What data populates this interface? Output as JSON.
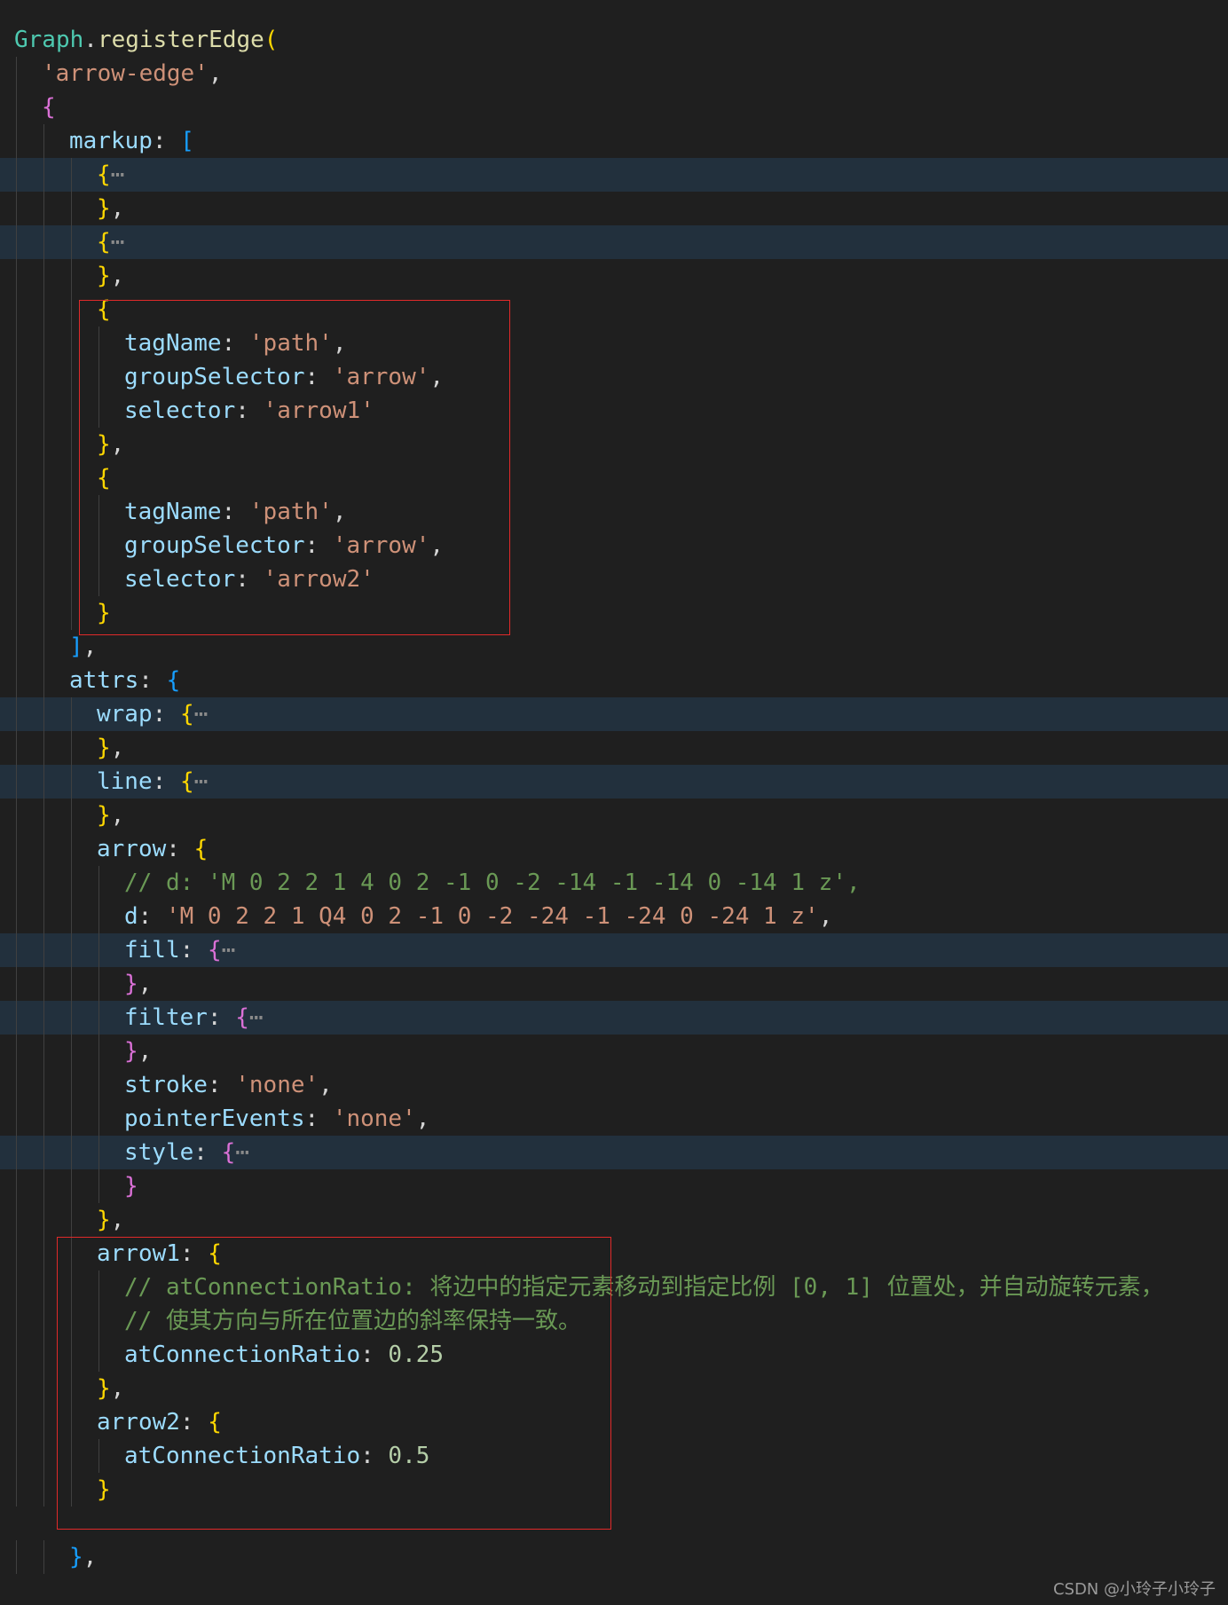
{
  "editor": {
    "colors": {
      "background": "#1f1f1f",
      "folded_line": "#22303d",
      "indent_guide": "#404040",
      "highlight_box": "#e02a2a"
    },
    "lines": [
      {
        "indent": 0,
        "folded": false,
        "tokens": [
          {
            "t": "Graph",
            "c": "#4ec9b0"
          },
          {
            "t": ".",
            "c": "#d4d4d4"
          },
          {
            "t": "registerEdge",
            "c": "#dcdcaa"
          },
          {
            "t": "(",
            "c": "#ffd700"
          }
        ]
      },
      {
        "indent": 1,
        "folded": false,
        "tokens": [
          {
            "t": "'arrow-edge'",
            "c": "#ce9178"
          },
          {
            "t": ",",
            "c": "#d4d4d4"
          }
        ]
      },
      {
        "indent": 1,
        "folded": false,
        "tokens": [
          {
            "t": "{",
            "c": "#da70d6"
          }
        ]
      },
      {
        "indent": 2,
        "folded": false,
        "tokens": [
          {
            "t": "markup",
            "c": "#9cdcfe"
          },
          {
            "t": ": ",
            "c": "#d4d4d4"
          },
          {
            "t": "[",
            "c": "#179fff"
          }
        ]
      },
      {
        "indent": 3,
        "folded": true,
        "tokens": [
          {
            "t": "{",
            "c": "#ffd700"
          },
          {
            "t": "⋯",
            "c": "#8a8a8a"
          }
        ]
      },
      {
        "indent": 3,
        "folded": false,
        "tokens": [
          {
            "t": "}",
            "c": "#ffd700"
          },
          {
            "t": ",",
            "c": "#d4d4d4"
          }
        ]
      },
      {
        "indent": 3,
        "folded": true,
        "tokens": [
          {
            "t": "{",
            "c": "#ffd700"
          },
          {
            "t": "⋯",
            "c": "#8a8a8a"
          }
        ]
      },
      {
        "indent": 3,
        "folded": false,
        "tokens": [
          {
            "t": "}",
            "c": "#ffd700"
          },
          {
            "t": ",",
            "c": "#d4d4d4"
          }
        ]
      },
      {
        "indent": 3,
        "folded": false,
        "tokens": [
          {
            "t": "{",
            "c": "#ffd700"
          }
        ]
      },
      {
        "indent": 4,
        "folded": false,
        "tokens": [
          {
            "t": "tagName",
            "c": "#9cdcfe"
          },
          {
            "t": ": ",
            "c": "#d4d4d4"
          },
          {
            "t": "'path'",
            "c": "#ce9178"
          },
          {
            "t": ",",
            "c": "#d4d4d4"
          }
        ]
      },
      {
        "indent": 4,
        "folded": false,
        "tokens": [
          {
            "t": "groupSelector",
            "c": "#9cdcfe"
          },
          {
            "t": ": ",
            "c": "#d4d4d4"
          },
          {
            "t": "'arrow'",
            "c": "#ce9178"
          },
          {
            "t": ",",
            "c": "#d4d4d4"
          }
        ]
      },
      {
        "indent": 4,
        "folded": false,
        "tokens": [
          {
            "t": "selector",
            "c": "#9cdcfe"
          },
          {
            "t": ": ",
            "c": "#d4d4d4"
          },
          {
            "t": "'arrow1'",
            "c": "#ce9178"
          }
        ]
      },
      {
        "indent": 3,
        "folded": false,
        "tokens": [
          {
            "t": "}",
            "c": "#ffd700"
          },
          {
            "t": ",",
            "c": "#d4d4d4"
          }
        ]
      },
      {
        "indent": 3,
        "folded": false,
        "tokens": [
          {
            "t": "{",
            "c": "#ffd700"
          }
        ]
      },
      {
        "indent": 4,
        "folded": false,
        "tokens": [
          {
            "t": "tagName",
            "c": "#9cdcfe"
          },
          {
            "t": ": ",
            "c": "#d4d4d4"
          },
          {
            "t": "'path'",
            "c": "#ce9178"
          },
          {
            "t": ",",
            "c": "#d4d4d4"
          }
        ]
      },
      {
        "indent": 4,
        "folded": false,
        "tokens": [
          {
            "t": "groupSelector",
            "c": "#9cdcfe"
          },
          {
            "t": ": ",
            "c": "#d4d4d4"
          },
          {
            "t": "'arrow'",
            "c": "#ce9178"
          },
          {
            "t": ",",
            "c": "#d4d4d4"
          }
        ]
      },
      {
        "indent": 4,
        "folded": false,
        "tokens": [
          {
            "t": "selector",
            "c": "#9cdcfe"
          },
          {
            "t": ": ",
            "c": "#d4d4d4"
          },
          {
            "t": "'arrow2'",
            "c": "#ce9178"
          }
        ]
      },
      {
        "indent": 3,
        "folded": false,
        "tokens": [
          {
            "t": "}",
            "c": "#ffd700"
          }
        ]
      },
      {
        "indent": 2,
        "folded": false,
        "tokens": [
          {
            "t": "]",
            "c": "#179fff"
          },
          {
            "t": ",",
            "c": "#d4d4d4"
          }
        ]
      },
      {
        "indent": 2,
        "folded": false,
        "tokens": [
          {
            "t": "attrs",
            "c": "#9cdcfe"
          },
          {
            "t": ": ",
            "c": "#d4d4d4"
          },
          {
            "t": "{",
            "c": "#179fff"
          }
        ]
      },
      {
        "indent": 3,
        "folded": true,
        "tokens": [
          {
            "t": "wrap",
            "c": "#9cdcfe"
          },
          {
            "t": ": ",
            "c": "#d4d4d4"
          },
          {
            "t": "{",
            "c": "#ffd700"
          },
          {
            "t": "⋯",
            "c": "#8a8a8a"
          }
        ]
      },
      {
        "indent": 3,
        "folded": false,
        "tokens": [
          {
            "t": "}",
            "c": "#ffd700"
          },
          {
            "t": ",",
            "c": "#d4d4d4"
          }
        ]
      },
      {
        "indent": 3,
        "folded": true,
        "tokens": [
          {
            "t": "line",
            "c": "#9cdcfe"
          },
          {
            "t": ": ",
            "c": "#d4d4d4"
          },
          {
            "t": "{",
            "c": "#ffd700"
          },
          {
            "t": "⋯",
            "c": "#8a8a8a"
          }
        ]
      },
      {
        "indent": 3,
        "folded": false,
        "tokens": [
          {
            "t": "}",
            "c": "#ffd700"
          },
          {
            "t": ",",
            "c": "#d4d4d4"
          }
        ]
      },
      {
        "indent": 3,
        "folded": false,
        "tokens": [
          {
            "t": "arrow",
            "c": "#9cdcfe"
          },
          {
            "t": ": ",
            "c": "#d4d4d4"
          },
          {
            "t": "{",
            "c": "#ffd700"
          }
        ]
      },
      {
        "indent": 4,
        "folded": false,
        "tokens": [
          {
            "t": "// d: 'M 0 2 2 1 4 0 2 -1 0 -2 -14 -1 -14 0 -14 1 z',",
            "c": "#6a9955"
          }
        ]
      },
      {
        "indent": 4,
        "folded": false,
        "tokens": [
          {
            "t": "d",
            "c": "#9cdcfe"
          },
          {
            "t": ": ",
            "c": "#d4d4d4"
          },
          {
            "t": "'M 0 2 2 1 Q4 0 2 -1 0 -2 -24 -1 -24 0 -24 1 z'",
            "c": "#ce9178"
          },
          {
            "t": ",",
            "c": "#d4d4d4"
          }
        ]
      },
      {
        "indent": 4,
        "folded": true,
        "tokens": [
          {
            "t": "fill",
            "c": "#9cdcfe"
          },
          {
            "t": ": ",
            "c": "#d4d4d4"
          },
          {
            "t": "{",
            "c": "#da70d6"
          },
          {
            "t": "⋯",
            "c": "#8a8a8a"
          }
        ]
      },
      {
        "indent": 4,
        "folded": false,
        "tokens": [
          {
            "t": "}",
            "c": "#da70d6"
          },
          {
            "t": ",",
            "c": "#d4d4d4"
          }
        ]
      },
      {
        "indent": 4,
        "folded": true,
        "tokens": [
          {
            "t": "filter",
            "c": "#9cdcfe"
          },
          {
            "t": ": ",
            "c": "#d4d4d4"
          },
          {
            "t": "{",
            "c": "#da70d6"
          },
          {
            "t": "⋯",
            "c": "#8a8a8a"
          }
        ]
      },
      {
        "indent": 4,
        "folded": false,
        "tokens": [
          {
            "t": "}",
            "c": "#da70d6"
          },
          {
            "t": ",",
            "c": "#d4d4d4"
          }
        ]
      },
      {
        "indent": 4,
        "folded": false,
        "tokens": [
          {
            "t": "stroke",
            "c": "#9cdcfe"
          },
          {
            "t": ": ",
            "c": "#d4d4d4"
          },
          {
            "t": "'none'",
            "c": "#ce9178"
          },
          {
            "t": ",",
            "c": "#d4d4d4"
          }
        ]
      },
      {
        "indent": 4,
        "folded": false,
        "tokens": [
          {
            "t": "pointerEvents",
            "c": "#9cdcfe"
          },
          {
            "t": ": ",
            "c": "#d4d4d4"
          },
          {
            "t": "'none'",
            "c": "#ce9178"
          },
          {
            "t": ",",
            "c": "#d4d4d4"
          }
        ]
      },
      {
        "indent": 4,
        "folded": true,
        "tokens": [
          {
            "t": "style",
            "c": "#9cdcfe"
          },
          {
            "t": ": ",
            "c": "#d4d4d4"
          },
          {
            "t": "{",
            "c": "#da70d6"
          },
          {
            "t": "⋯",
            "c": "#8a8a8a"
          }
        ]
      },
      {
        "indent": 4,
        "folded": false,
        "tokens": [
          {
            "t": "}",
            "c": "#da70d6"
          }
        ]
      },
      {
        "indent": 3,
        "folded": false,
        "tokens": [
          {
            "t": "}",
            "c": "#ffd700"
          },
          {
            "t": ",",
            "c": "#d4d4d4"
          }
        ]
      },
      {
        "indent": 3,
        "folded": false,
        "tokens": [
          {
            "t": "arrow1",
            "c": "#9cdcfe"
          },
          {
            "t": ": ",
            "c": "#d4d4d4"
          },
          {
            "t": "{",
            "c": "#ffd700"
          }
        ]
      },
      {
        "indent": 4,
        "folded": false,
        "tokens": [
          {
            "t": "// atConnectionRatio: 将边中的指定元素移动到指定比例 [0, 1] 位置处，并自动旋转元素，",
            "c": "#6a9955"
          }
        ]
      },
      {
        "indent": 4,
        "folded": false,
        "tokens": [
          {
            "t": "// 使其方向与所在位置边的斜率保持一致。",
            "c": "#6a9955"
          }
        ]
      },
      {
        "indent": 4,
        "folded": false,
        "tokens": [
          {
            "t": "atConnectionRatio",
            "c": "#9cdcfe"
          },
          {
            "t": ": ",
            "c": "#d4d4d4"
          },
          {
            "t": "0.25",
            "c": "#b5cea8"
          }
        ]
      },
      {
        "indent": 3,
        "folded": false,
        "tokens": [
          {
            "t": "}",
            "c": "#ffd700"
          },
          {
            "t": ",",
            "c": "#d4d4d4"
          }
        ]
      },
      {
        "indent": 3,
        "folded": false,
        "tokens": [
          {
            "t": "arrow2",
            "c": "#9cdcfe"
          },
          {
            "t": ": ",
            "c": "#d4d4d4"
          },
          {
            "t": "{",
            "c": "#ffd700"
          }
        ]
      },
      {
        "indent": 4,
        "folded": false,
        "tokens": [
          {
            "t": "atConnectionRatio",
            "c": "#9cdcfe"
          },
          {
            "t": ": ",
            "c": "#d4d4d4"
          },
          {
            "t": "0.5",
            "c": "#b5cea8"
          }
        ]
      },
      {
        "indent": 3,
        "folded": false,
        "tokens": [
          {
            "t": "}",
            "c": "#ffd700"
          }
        ]
      },
      {
        "indent": 0,
        "folded": false,
        "tokens": []
      },
      {
        "indent": 2,
        "folded": false,
        "tokens": [
          {
            "t": "}",
            "c": "#179fff"
          },
          {
            "t": ",",
            "c": "#d4d4d4"
          }
        ]
      }
    ]
  },
  "watermark": {
    "text": "CSDN @小玲子小玲子"
  }
}
